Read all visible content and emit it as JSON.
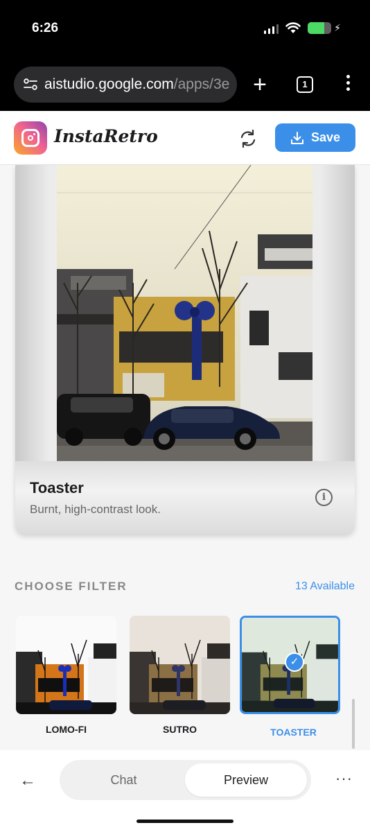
{
  "status_bar": {
    "time": "6:26",
    "battery_level": 0.7
  },
  "browser": {
    "url_host": "aistudio.google.com",
    "url_path": "/apps/3e",
    "tab_count": "1"
  },
  "header": {
    "app_name": "InstaRetro",
    "save_label": "Save",
    "refresh_icon": "refresh-icon",
    "download_icon": "download-icon"
  },
  "preview": {
    "filter_name": "Toaster",
    "filter_description": "Burnt, high-contrast look."
  },
  "filters_section": {
    "title": "CHOOSE FILTER",
    "count_label": "13 Available",
    "items": [
      {
        "label": "LOMO-FI",
        "selected": false
      },
      {
        "label": "SUTRO",
        "selected": false
      },
      {
        "label": "TOASTER",
        "selected": true
      }
    ]
  },
  "bottom_nav": {
    "tabs": [
      {
        "label": "Chat",
        "active": false
      },
      {
        "label": "Preview",
        "active": true
      }
    ]
  },
  "colors": {
    "accent": "#3b8fe8",
    "battery": "#4cd964"
  }
}
